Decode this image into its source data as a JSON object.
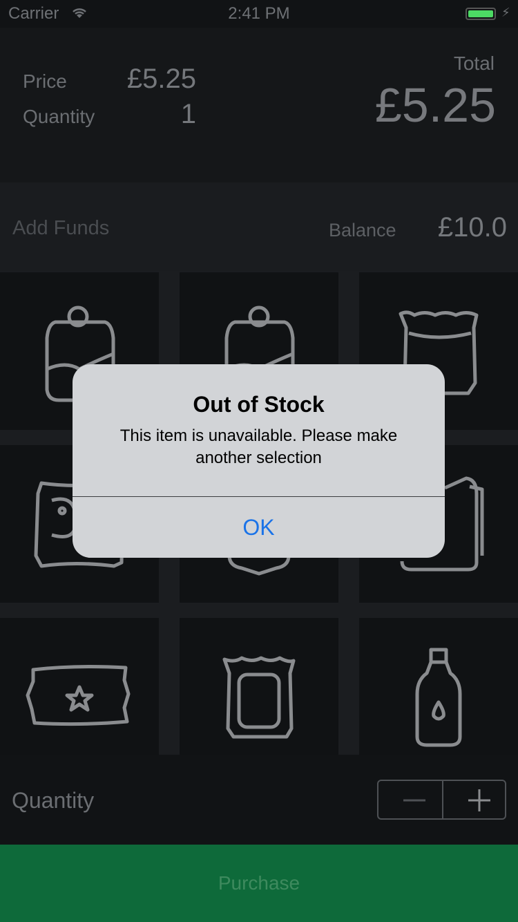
{
  "status_bar": {
    "carrier": "Carrier",
    "time": "2:41 PM",
    "battery_color": "#4cd964"
  },
  "summary": {
    "price_label": "Price",
    "price_value": "£5.25",
    "quantity_label": "Quantity",
    "quantity_value": "1",
    "total_label": "Total",
    "total_value": "£5.25"
  },
  "funds": {
    "add_funds_label": "Add Funds",
    "balance_label": "Balance",
    "balance_value": "£10.0"
  },
  "products": [
    {
      "icon": "can-icon"
    },
    {
      "icon": "can-icon"
    },
    {
      "icon": "chips-bag-icon"
    },
    {
      "icon": "snack-bag-icon"
    },
    {
      "icon": "pouch-icon"
    },
    {
      "icon": "wafer-pack-icon"
    },
    {
      "icon": "candy-bar-icon"
    },
    {
      "icon": "crisps-bag-icon"
    },
    {
      "icon": "water-bottle-icon"
    }
  ],
  "quantity_row": {
    "label": "Quantity",
    "minus_icon": "minus-icon",
    "plus_icon": "plus-icon"
  },
  "purchase": {
    "label": "Purchase",
    "color": "#0e6a3a"
  },
  "alert": {
    "title": "Out of Stock",
    "message": "This item is unavailable. Please make another selection",
    "ok_label": "OK",
    "ok_color": "#1a73e8"
  }
}
